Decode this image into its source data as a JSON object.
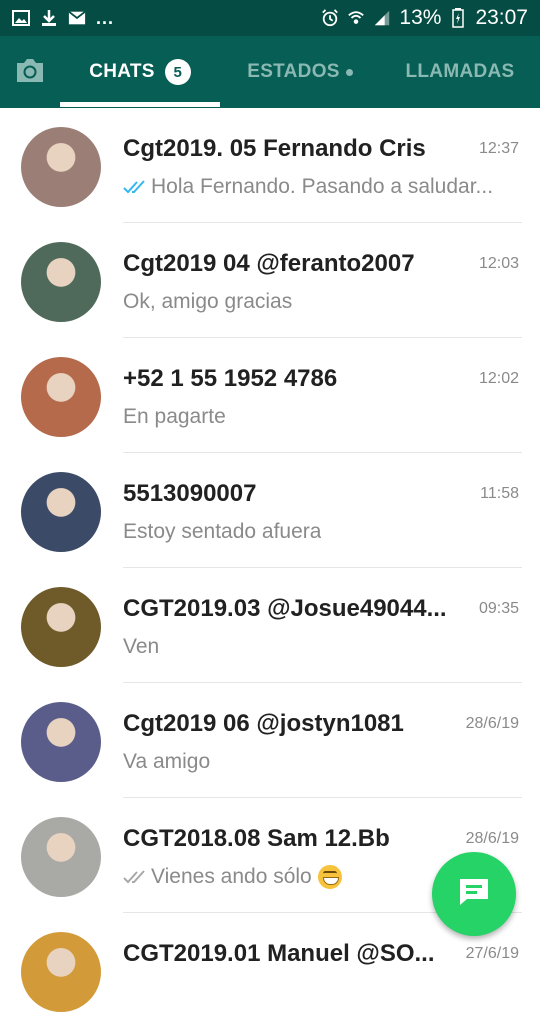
{
  "status_bar": {
    "battery": "13%",
    "time": "23:07",
    "dots": "...",
    "icons": [
      "image-icon",
      "download-icon",
      "mail-icon",
      "alarm-icon",
      "wifi-icon",
      "signal-icon",
      "battery-icon"
    ]
  },
  "tabs": {
    "chats": {
      "label": "CHATS",
      "badge": "5"
    },
    "status": {
      "label": "ESTADOS"
    },
    "calls": {
      "label": "LLAMADAS"
    }
  },
  "chats": [
    {
      "name": "Cgt2019. 05 Fernando Cris",
      "time": "12:37",
      "message": "Hola Fernando. Pasando a saludar...",
      "ticks": "read",
      "avatar_color": "#9b7f76"
    },
    {
      "name": "Cgt2019 04 @feranto2007",
      "time": "12:03",
      "message": "Ok, amigo gracias",
      "ticks": "",
      "avatar_color": "#4f6a5a"
    },
    {
      "name": "+52 1 55 1952 4786",
      "time": "12:02",
      "message": "En pagarte",
      "ticks": "",
      "avatar_color": "#b46a4b"
    },
    {
      "name": "5513090007",
      "time": "11:58",
      "message": "Estoy sentado afuera",
      "ticks": "",
      "avatar_color": "#3b4a66"
    },
    {
      "name": "CGT2019.03 @Josue49044...",
      "time": "09:35",
      "message": "Ven",
      "ticks": "",
      "avatar_color": "#6f5a2a"
    },
    {
      "name": "Cgt2019 06 @jostyn1081",
      "time": "28/6/19",
      "message": "Va amigo",
      "ticks": "",
      "avatar_color": "#5a5d8a"
    },
    {
      "name": "CGT2018.08 Sam 12.Bb",
      "time": "28/6/19",
      "message": "Vienes ando sólo",
      "ticks": "sent",
      "avatar_color": "#a9a9a5"
    },
    {
      "name": "CGT2019.01 Manuel @SO...",
      "time": "27/6/19",
      "message": "",
      "ticks": "",
      "avatar_color": "#d29a39"
    }
  ],
  "colors": {
    "header": "#075e54",
    "statusbar": "#054d44",
    "fab": "#25d366",
    "read_tick": "#34b7f1"
  }
}
